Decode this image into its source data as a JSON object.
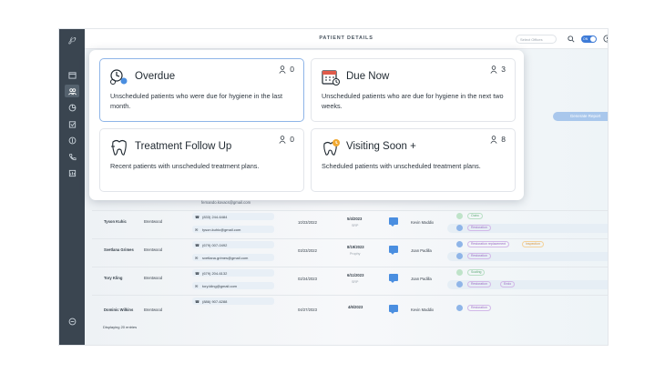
{
  "header": {
    "title": "PATIENT DETAILS",
    "office_placeholder": "Select Offices",
    "toggle_label": "ON"
  },
  "sidebar": {
    "logo": "℘",
    "items": [
      "calendar-icon",
      "patients-icon",
      "chart-icon",
      "schedule-icon",
      "money-icon",
      "phone-icon",
      "reports-icon"
    ],
    "bottom": "logout-icon"
  },
  "actions": {
    "generate_report": "Generate Report"
  },
  "popup": {
    "cards": [
      {
        "title": "Overdue",
        "description": "Unscheduled patients who were due for hygiene in the last month.",
        "count": "0",
        "icon": "overdue-icon",
        "selected": true
      },
      {
        "title": "Due Now",
        "description": "Unscheduled patients who are due for hygiene in the next two weeks.",
        "count": "3",
        "icon": "calendar-due-icon",
        "selected": false
      },
      {
        "title": "Treatment Follow Up",
        "description": "Recent patients with unscheduled treatment plans.",
        "count": "0",
        "icon": "tooth-icon",
        "selected": false
      },
      {
        "title": "Visiting Soon +",
        "description": "Scheduled patients with unscheduled treatment plans.",
        "count": "8",
        "icon": "visiting-soon-icon",
        "selected": false
      }
    ]
  },
  "table": {
    "partial_email": "fernando.kovacs@gmail.com",
    "rows": [
      {
        "name": "Tyson Kuhic",
        "location": "Brentwood",
        "phone": "(833) 244-6484",
        "email": "tyson.kuhic@gmail.com",
        "last_visit": "10/23/2022",
        "appt_date": "5/4/2023",
        "appt_type": "SRP",
        "provider": "Kevin Maddix",
        "tags": [
          "Outro",
          "Restoration"
        ]
      },
      {
        "name": "Svetlana Grimes",
        "location": "Brentwood",
        "phone": "(679) 007-0492",
        "email": "svetlana.grimes@gmail.com",
        "last_visit": "03/23/2022",
        "appt_date": "8/19/2023",
        "appt_type": "Prophy",
        "provider": "Joan Padilla",
        "tags": [
          "Restoration replacement",
          "Inspection",
          "Restoration"
        ]
      },
      {
        "name": "Tory Kling",
        "location": "Brentwood",
        "phone": "(679) 204-6132",
        "email": "tory.kling@gmail.com",
        "last_visit": "02/24/2023",
        "appt_date": "6/11/2023",
        "appt_type": "SRP",
        "provider": "Joan Padilla",
        "tags": [
          "Scaling",
          "Restoration",
          "Endo"
        ]
      },
      {
        "name": "Dominic Wilkins",
        "location": "Brentwood",
        "phone": "(886) 907-6288",
        "email": "",
        "last_visit": "04/27/2023",
        "appt_date": "4/6/2023",
        "appt_type": "",
        "provider": "Kevin Maddix",
        "tags": [
          "Restoration"
        ]
      }
    ],
    "footer": "Displaying 20 entries"
  },
  "colors": {
    "accent": "#3e7bd7",
    "sidebar": "#3a4550",
    "tag_purple": "#9a6bc4",
    "tag_green": "#5aa873",
    "tag_orange": "#d7953a"
  }
}
